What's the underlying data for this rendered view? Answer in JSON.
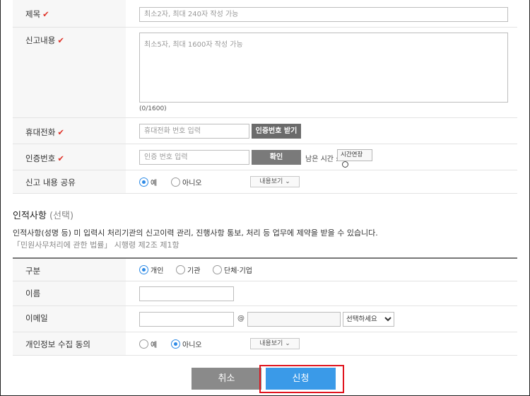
{
  "form": {
    "title_label": "제목",
    "title_placeholder": "최소2자, 최대 240자 작성 가능",
    "content_label": "신고내용",
    "content_placeholder": "최소5자, 최대 1600자 작성 가능",
    "content_counter": "(0/1600)",
    "phone_label": "휴대전화",
    "phone_placeholder": "휴대전화 번호 입력",
    "phone_button": "인증번호 받기",
    "auth_label": "인증번호",
    "auth_placeholder": "인증 번호 입력",
    "auth_confirm": "확인",
    "remain_label": "남은 시간 :",
    "extend_button": "시간연장",
    "share_label": "신고 내용 공유",
    "share_yes": "예",
    "share_no": "아니오",
    "share_selected": "예",
    "view_more": "내용보기"
  },
  "person": {
    "section_title": "인적사항",
    "section_optional": "(선택)",
    "notice": "인적사항(성명 등) 미 입력시 처리기관의 신고이력 관리, 진행사항 통보, 처리 등 업무에 제약을 받을 수 있습니다.",
    "law_ref": "「민원사무처리에 관한 법률」 시행령 제2조 제1항",
    "type_label": "구분",
    "type_options": [
      "개인",
      "기관",
      "단체·기업"
    ],
    "type_selected": "개인",
    "name_label": "이름",
    "email_label": "이메일",
    "email_at": "@",
    "email_select": "선택하세요",
    "consent_label": "개인정보 수집 동의",
    "consent_yes": "예",
    "consent_no": "아니오",
    "consent_selected": "아니오",
    "view_more": "내용보기"
  },
  "actions": {
    "cancel": "취소",
    "submit": "신청"
  },
  "colors": {
    "accent": "#2e8be6",
    "required_mark": "#e0362c",
    "highlight_box": "#e0141e",
    "dark_button": "#6b6b6b",
    "cancel_button": "#8a8a8a",
    "submit_button": "#3a9ae8"
  }
}
